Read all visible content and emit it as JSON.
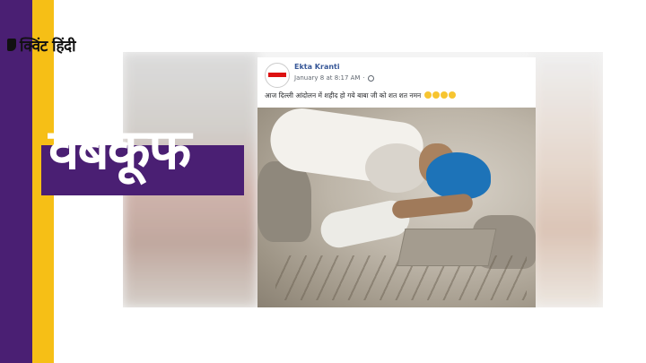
{
  "brand": {
    "logo_text": "क्विंट हिंदी"
  },
  "headline": {
    "text": "वेबकूफ"
  },
  "post": {
    "page_name": "Ekta Kranti",
    "date": "January 8 at 8:17 AM",
    "caption": "आज दिल्ली आंदोलन में शहीद हो गये बाबा जी को शत शत नमन",
    "emoji_count": 4
  },
  "colors": {
    "purple": "#4a1f73",
    "yellow": "#f6bf16",
    "facebook_link": "#385898",
    "turban_blue": "#1d73b8"
  },
  "icons": [
    "quint-logo-mark-icon",
    "globe-icon",
    "crying-emoji-icon"
  ]
}
